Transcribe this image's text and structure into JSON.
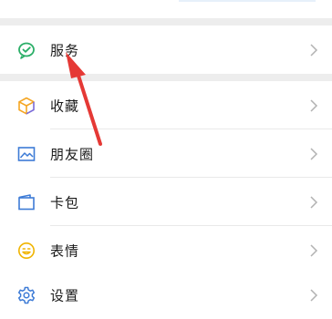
{
  "menu": {
    "service_label": "服务",
    "favorites_label": "收藏",
    "moments_label": "朋友圈",
    "cards_label": "卡包",
    "stickers_label": "表情",
    "settings_label": "设置"
  },
  "icons": {
    "service": "wechat-pay-check-icon",
    "favorites": "cube-icon",
    "moments": "picture-icon",
    "cards": "wallet-icon",
    "stickers": "smiley-icon",
    "settings": "gear-icon",
    "chevron": "chevron-right-icon"
  },
  "colors": {
    "background": "#ededed",
    "row_background": "#ffffff",
    "service_green": "#2aae67",
    "favorites_orange": "#f5a623",
    "favorites_purple": "#7b6cd8",
    "blue_icon": "#3d7bd6",
    "stickers_yellow": "#f0b400",
    "annotation_arrow": "#e53935"
  }
}
